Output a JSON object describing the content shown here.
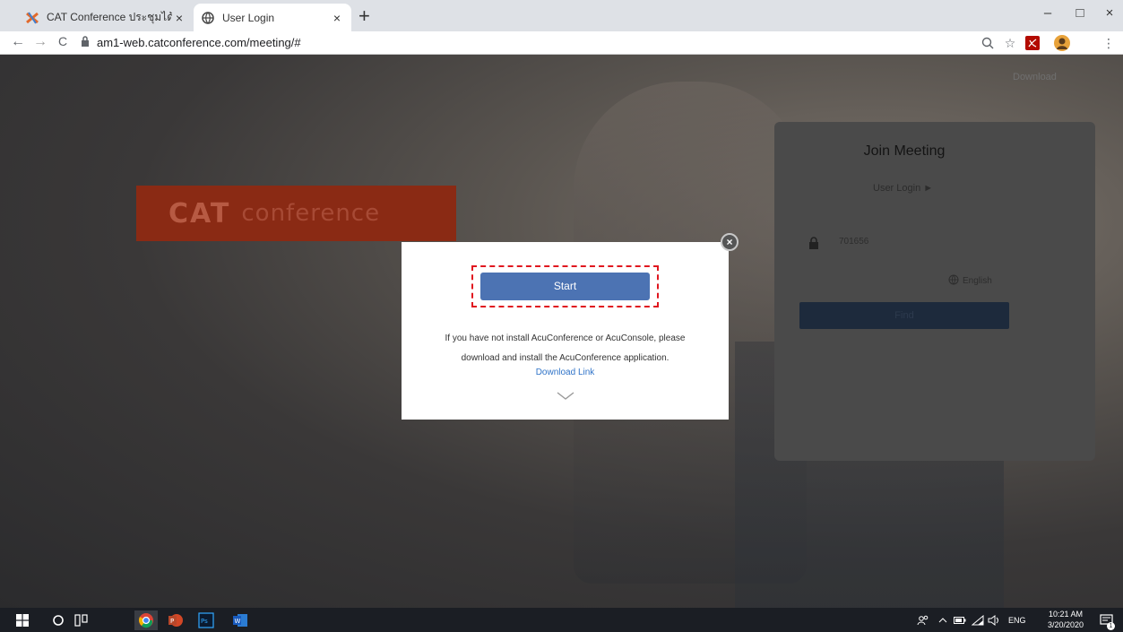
{
  "browser": {
    "tabs": [
      {
        "title": "CAT Conference ประชุมได้ใช้ยืดจ่ายใ",
        "active": false
      },
      {
        "title": "User Login",
        "active": true
      }
    ],
    "new_tab_label": "+",
    "close_tab_label": "×",
    "window": {
      "minimize": "–",
      "maximize": "□",
      "close": "×"
    },
    "nav": {
      "back": "←",
      "forward": "→",
      "reload": "C"
    },
    "url": "am1-web.catconference.com/meeting/#"
  },
  "page": {
    "top_download": "Download",
    "logo": {
      "brand": "CAT",
      "suffix": "conference"
    },
    "join_panel": {
      "title": "Join Meeting",
      "user_login": "User Login ►",
      "meeting_id": "701656",
      "language": "English",
      "find_button": "Find"
    },
    "modal": {
      "start_button": "Start",
      "message_line1": "If you have not install AcuConference or AcuConsole, please",
      "message_line2": "download and install the AcuConference application.",
      "download_link": "Download Link",
      "close_label": "×"
    }
  },
  "taskbar": {
    "language": "ENG",
    "time": "10:21 AM",
    "date": "3/20/2020",
    "notification_count": "1"
  },
  "colors": {
    "modal_button": "#4c73b3",
    "highlight_border": "#e0171f",
    "link": "#2f73c8",
    "logo_bg": "#8a2a14"
  }
}
